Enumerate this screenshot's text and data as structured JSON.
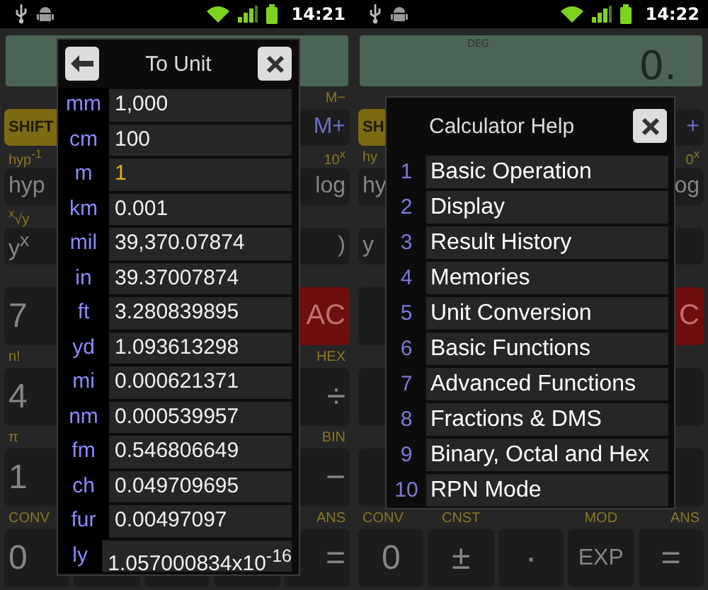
{
  "screens": [
    {
      "time": "14:21",
      "rows": [
        {
          "keys": [
            {
              "text": "SHIFT",
              "kind": "shift"
            },
            {
              "kind": "covered"
            },
            {
              "kind": "covered"
            },
            {
              "kind": "covered"
            },
            {
              "text": "M+",
              "kind": "memory",
              "label": "M−"
            }
          ]
        },
        {
          "keys": [
            {
              "text": "hyp",
              "kind": "normal",
              "label": "hyp$^{-1}$"
            },
            {
              "kind": "covered"
            },
            {
              "kind": "covered"
            },
            {
              "kind": "covered"
            },
            {
              "text": "log",
              "kind": "normal",
              "label": "10$^{x}$"
            }
          ]
        },
        {
          "keys": [
            {
              "text": "y$^{x}$",
              "kind": "normal",
              "label": "$^{x}$√y"
            },
            {
              "kind": "covered"
            },
            {
              "kind": "covered"
            },
            {
              "kind": "covered"
            },
            {
              "text": ")",
              "kind": "normal"
            }
          ]
        },
        {
          "keys": [
            {
              "text": "7",
              "kind": "digit"
            },
            {
              "kind": "covered"
            },
            {
              "kind": "covered"
            },
            {
              "kind": "covered"
            },
            {
              "text": "AC",
              "kind": "clear"
            }
          ]
        },
        {
          "keys": [
            {
              "text": "4",
              "kind": "digit",
              "label": "n!"
            },
            {
              "kind": "covered"
            },
            {
              "kind": "covered"
            },
            {
              "kind": "covered"
            },
            {
              "text": "÷",
              "kind": "digit",
              "label": "HEX"
            }
          ]
        },
        {
          "keys": [
            {
              "text": "1",
              "kind": "digit",
              "label": "π"
            },
            {
              "kind": "covered"
            },
            {
              "kind": "covered"
            },
            {
              "kind": "covered"
            },
            {
              "text": "−",
              "kind": "digit",
              "label": "BIN"
            }
          ]
        },
        {
          "keys": [
            {
              "text": "0",
              "kind": "digit",
              "label": "CONV"
            },
            {
              "kind": "blank"
            },
            {
              "kind": "blank"
            },
            {
              "kind": "blank"
            },
            {
              "text": "=",
              "kind": "digit",
              "label": "ANS"
            }
          ]
        }
      ],
      "dialog": {
        "kind": "units",
        "title": "To Unit",
        "units": [
          {
            "unit": "mm",
            "value": "1,000",
            "selected": false
          },
          {
            "unit": "cm",
            "value": "100",
            "selected": false
          },
          {
            "unit": "m",
            "value": "1",
            "selected": true
          },
          {
            "unit": "km",
            "value": "0.001",
            "selected": false
          },
          {
            "unit": "mil",
            "value": "39,370.07874",
            "selected": false
          },
          {
            "unit": "in",
            "value": "39.37007874",
            "selected": false
          },
          {
            "unit": "ft",
            "value": "3.280839895",
            "selected": false
          },
          {
            "unit": "yd",
            "value": "1.093613298",
            "selected": false
          },
          {
            "unit": "mi",
            "value": "0.000621371",
            "selected": false
          },
          {
            "unit": "nm",
            "value": "0.000539957",
            "selected": false
          },
          {
            "unit": "fm",
            "value": "0.546806649",
            "selected": false
          },
          {
            "unit": "ch",
            "value": "0.049709695",
            "selected": false
          },
          {
            "unit": "fur",
            "value": "0.00497097",
            "selected": false
          },
          {
            "unit": "ly",
            "value": "1.057000834x10$^{-16}$",
            "selected": false
          }
        ]
      }
    },
    {
      "time": "14:22",
      "display": {
        "mode": "DEG",
        "value": "0."
      },
      "rows": [
        {
          "keys": [
            {
              "text": "SH",
              "kind": "shift"
            },
            {
              "kind": "covered"
            },
            {
              "kind": "covered"
            },
            {
              "kind": "covered"
            },
            {
              "text": "+",
              "kind": "memory"
            }
          ]
        },
        {
          "keys": [
            {
              "text": "hy",
              "kind": "normal",
              "label": "hy"
            },
            {
              "kind": "covered"
            },
            {
              "kind": "covered"
            },
            {
              "kind": "covered"
            },
            {
              "text": "og",
              "kind": "normal",
              "label": "0$^{x}$"
            }
          ]
        },
        {
          "keys": [
            {
              "text": "y",
              "kind": "normal"
            },
            {
              "kind": "covered"
            },
            {
              "kind": "covered"
            },
            {
              "kind": "covered"
            },
            {
              "kind": "blank"
            }
          ]
        },
        {
          "keys": [
            {
              "kind": "blank"
            },
            {
              "kind": "covered"
            },
            {
              "kind": "covered"
            },
            {
              "kind": "covered"
            },
            {
              "text": "C",
              "kind": "clear"
            }
          ]
        },
        {
          "keys": [
            {
              "kind": "blank"
            },
            {
              "kind": "covered"
            },
            {
              "kind": "covered"
            },
            {
              "kind": "covered"
            },
            {
              "kind": "blank"
            }
          ]
        },
        {
          "keys": [
            {
              "kind": "blank"
            },
            {
              "kind": "covered"
            },
            {
              "kind": "covered"
            },
            {
              "kind": "covered"
            },
            {
              "kind": "blank"
            }
          ]
        },
        {
          "keys": [
            {
              "text": "0",
              "kind": "digit",
              "label": "CONV"
            },
            {
              "text": "±",
              "kind": "digit",
              "label": "CNST"
            },
            {
              "text": "·",
              "kind": "digit"
            },
            {
              "text": "EXP",
              "kind": "normal",
              "label": "MOD"
            },
            {
              "text": "=",
              "kind": "digit",
              "label": "ANS"
            }
          ]
        }
      ],
      "dialog": {
        "kind": "help",
        "title": "Calculator Help",
        "items": [
          {
            "number": "1",
            "label": "Basic Operation"
          },
          {
            "number": "2",
            "label": "Display"
          },
          {
            "number": "3",
            "label": "Result History"
          },
          {
            "number": "4",
            "label": "Memories"
          },
          {
            "number": "5",
            "label": "Unit Conversion"
          },
          {
            "number": "6",
            "label": "Basic Functions"
          },
          {
            "number": "7",
            "label": "Advanced Functions"
          },
          {
            "number": "8",
            "label": "Fractions & DMS"
          },
          {
            "number": "9",
            "label": "Binary, Octal and Hex"
          },
          {
            "number": "10",
            "label": "RPN Mode"
          }
        ]
      }
    }
  ]
}
